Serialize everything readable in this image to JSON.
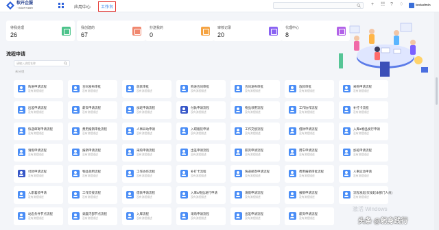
{
  "header": {
    "brand": "软开企服",
    "brand_sub": "一站式软件开发服务",
    "tabs": [
      {
        "label": "应用中心"
      },
      {
        "label": "工作台"
      }
    ],
    "search": {
      "placeholder": ""
    },
    "username": "testadmin",
    "accent": "#1a73e8",
    "highlight": "#e53935"
  },
  "stats": [
    {
      "label": "待我处理",
      "value": "26",
      "icon": "doc-icon",
      "color": "#4cc38a"
    },
    {
      "label": "我创建的",
      "value": "67",
      "icon": "image-icon",
      "color": "#f0876e"
    },
    {
      "label": "抄送我的",
      "value": "0",
      "icon": "copy-icon",
      "color": "#f5a341"
    },
    {
      "label": "审核记录",
      "value": "20",
      "icon": "check-icon",
      "color": "#8a63f2"
    },
    {
      "label": "代理中心",
      "value": "8",
      "icon": "list-icon",
      "color": "#b262e8"
    }
  ],
  "section": {
    "title": "流程申请",
    "search_placeholder": "请输入流程名称",
    "category": "未分组"
  },
  "flows": [
    {
      "name": "购进申请流程",
      "desc": "没有流程描述",
      "icon": "user-icon"
    },
    {
      "name": "合同发布审批",
      "desc": "没有流程描述",
      "icon": "user-icon"
    },
    {
      "name": "放款审批",
      "desc": "没有流程描述",
      "icon": "user-icon"
    },
    {
      "name": "购进合同审批",
      "desc": "没有流程描述",
      "icon": "user-icon"
    },
    {
      "name": "合同发布审批",
      "desc": "没有流程描述",
      "icon": "user-icon"
    },
    {
      "name": "放款审批",
      "desc": "没有流程描述",
      "icon": "user-icon"
    },
    {
      "name": "采购申请流程",
      "desc": "没有流程描述",
      "icon": "user-icon"
    },
    {
      "name": "出差申请流程",
      "desc": "没有流程描述",
      "icon": "user-icon"
    },
    {
      "name": "薪资申请流程",
      "desc": "没有流程描述",
      "icon": "user-icon"
    },
    {
      "name": "加班申请流程",
      "desc": "没有流程描述",
      "icon": "user-icon"
    },
    {
      "name": "付款申请流程",
      "desc": "没有流程描述",
      "icon": "card-icon"
    },
    {
      "name": "物品领用流程",
      "desc": "没有流程描述",
      "icon": "user-icon"
    },
    {
      "name": "工作协作流程",
      "desc": "没有流程描述",
      "icon": "user-icon"
    },
    {
      "name": "补打卡流程",
      "desc": "没有流程描述",
      "icon": "user-icon"
    },
    {
      "name": "快递邮寄申请流程",
      "desc": "没有流程描述",
      "icon": "user-icon"
    },
    {
      "name": "费用报销审批流程",
      "desc": "没有流程描述",
      "icon": "user-icon"
    },
    {
      "name": "人事异动申请",
      "desc": "没有流程描述",
      "icon": "user-icon"
    },
    {
      "name": "入职着装申请",
      "desc": "没有流程描述",
      "icon": "user-icon"
    },
    {
      "name": "工作交接流程",
      "desc": "没有流程描述",
      "icon": "user-icon"
    },
    {
      "name": "借款申请流程",
      "desc": "没有流程描述",
      "icon": "user-icon"
    },
    {
      "name": "入库&物品发行申请",
      "desc": "没有流程描述",
      "icon": "user-icon"
    },
    {
      "name": "请假申请流程",
      "desc": "没有流程描述",
      "icon": "user-icon"
    },
    {
      "name": "报销申请流程",
      "desc": "没有流程描述",
      "icon": "user-icon"
    },
    {
      "name": "采购申请流程",
      "desc": "没有流程描述",
      "icon": "user-icon"
    },
    {
      "name": "出差申请流程",
      "desc": "没有流程描述",
      "icon": "user-icon"
    },
    {
      "name": "薪资申请流程",
      "desc": "没有流程描述",
      "icon": "user-icon"
    },
    {
      "name": "用车申请流程",
      "desc": "没有流程描述",
      "icon": "user-icon"
    },
    {
      "name": "加班申请流程",
      "desc": "没有流程描述",
      "icon": "user-icon"
    },
    {
      "name": "付款申请流程",
      "desc": "没有流程描述",
      "icon": "card-icon"
    },
    {
      "name": "物品领用流程",
      "desc": "没有流程描述",
      "icon": "user-icon"
    },
    {
      "name": "工作协作流程",
      "desc": "没有流程描述",
      "icon": "user-icon"
    },
    {
      "name": "补打卡流程",
      "desc": "没有流程描述",
      "icon": "user-icon"
    },
    {
      "name": "快递邮寄申请流程",
      "desc": "没有流程描述",
      "icon": "user-icon"
    },
    {
      "name": "费用报销审批流程",
      "desc": "没有流程描述",
      "icon": "user-icon"
    },
    {
      "name": "人事异动申请",
      "desc": "没有流程描述",
      "icon": "user-icon"
    },
    {
      "name": "入职着装申请",
      "desc": "没有流程描述",
      "icon": "user-icon"
    },
    {
      "name": "工作交接流程",
      "desc": "没有流程描述",
      "icon": "user-icon"
    },
    {
      "name": "借款申请流程",
      "desc": "没有流程描述",
      "icon": "user-icon"
    },
    {
      "name": "入库&物品发行申请",
      "desc": "没有流程描述",
      "icon": "user-icon"
    },
    {
      "name": "请假申请流程",
      "desc": "没有流程描述",
      "icon": "user-icon"
    },
    {
      "name": "报销申请流程",
      "desc": "没有流程描述",
      "icon": "user-icon"
    },
    {
      "name": "流程发起(仅发起本部门人员)",
      "desc": "没有流程描述",
      "icon": "user-icon"
    },
    {
      "name": "动态条件节点流程",
      "desc": "没有流程描述",
      "icon": "user-icon"
    },
    {
      "name": "调度内部节点流程",
      "desc": "没有流程描述",
      "icon": "user-icon"
    },
    {
      "name": "入库流程",
      "desc": "没有流程描述",
      "icon": "user-icon"
    },
    {
      "name": "采购申请流程",
      "desc": "没有流程描述",
      "icon": "user-icon"
    },
    {
      "name": "出差申请流程",
      "desc": "没有流程描述",
      "icon": "user-icon"
    },
    {
      "name": "薪资申请流程",
      "desc": "没有流程描述",
      "icon": "user-icon"
    }
  ],
  "watermarks": {
    "windows": "激活 Windows",
    "credit": "头条 @躬身践行"
  }
}
